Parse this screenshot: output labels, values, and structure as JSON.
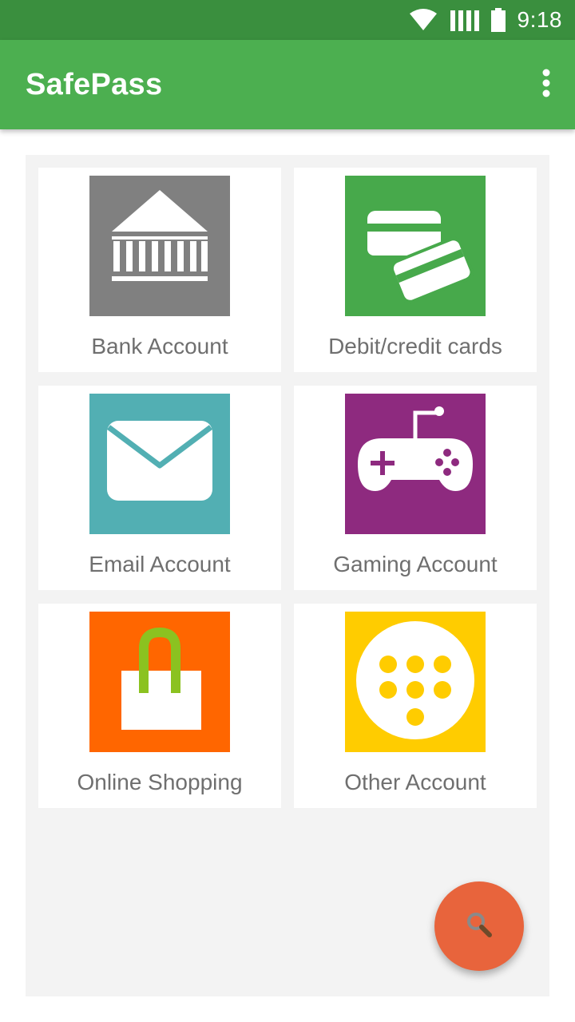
{
  "status_bar": {
    "time": "9:18",
    "icons": [
      "wifi-icon",
      "signal-icon",
      "battery-icon"
    ]
  },
  "app_bar": {
    "title": "SafePass",
    "overflow_icon": "more-vert-icon"
  },
  "categories": [
    {
      "label": "Bank Account",
      "icon": "bank-icon",
      "color": "#808080"
    },
    {
      "label": "Debit/credit cards",
      "icon": "credit-cards-icon",
      "color": "#47a94b"
    },
    {
      "label": "Email Account",
      "icon": "envelope-icon",
      "color": "#52afb3"
    },
    {
      "label": "Gaming Account",
      "icon": "gamepad-icon",
      "color": "#8e2a7f"
    },
    {
      "label": "Online Shopping",
      "icon": "shopping-bag-icon",
      "color": "#ff6600"
    },
    {
      "label": "Other Account",
      "icon": "dots-circle-icon",
      "color": "#ffcc00"
    }
  ],
  "fab": {
    "icon": "search-icon",
    "color": "#e8643c"
  },
  "colors": {
    "status_bar": "#3a8f3e",
    "app_bar": "#4caf50",
    "content_bg": "#f3f3f3",
    "label_text": "#6f6f6f"
  }
}
